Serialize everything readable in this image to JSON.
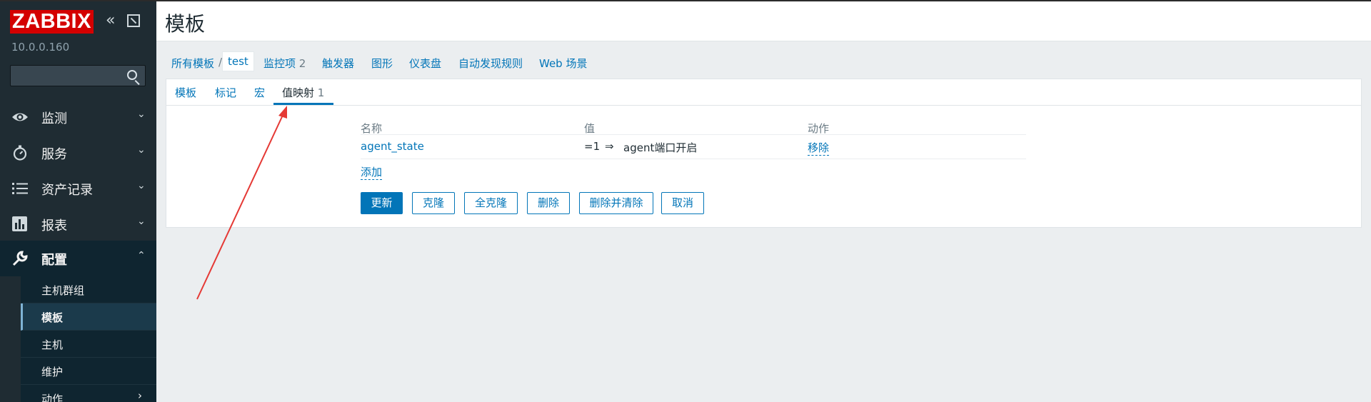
{
  "sidebar": {
    "logo": "ZABBIX",
    "version": "10.0.0.160",
    "search": {
      "value": "",
      "placeholder": ""
    },
    "icons": {
      "collapse": "double-chevron-left-icon",
      "kiosk": "kiosk-mode-icon",
      "search": "search-icon"
    },
    "menu": [
      {
        "label": "监测",
        "icon": "eye-icon",
        "chevron": "⌄"
      },
      {
        "label": "服务",
        "icon": "stopwatch-icon",
        "chevron": "⌄"
      },
      {
        "label": "资产记录",
        "icon": "list-icon",
        "chevron": "⌄"
      },
      {
        "label": "报表",
        "icon": "bar-chart-icon",
        "chevron": "⌄"
      },
      {
        "label": "配置",
        "icon": "wrench-icon",
        "chevron": "⌃"
      }
    ],
    "submenu": [
      {
        "label": "主机群组"
      },
      {
        "label": "模板"
      },
      {
        "label": "主机"
      },
      {
        "label": "维护"
      },
      {
        "label": "动作",
        "chevron": "›"
      }
    ]
  },
  "header": {
    "title": "模板"
  },
  "breadcrumb": {
    "all_templates": "所有模板",
    "separator": "/",
    "current": "test",
    "items_label": "监控项",
    "items_count": "2",
    "triggers": "触发器",
    "graphs": "图形",
    "dashboards": "仪表盘",
    "discovery": "自动发现规则",
    "web": "Web 场景"
  },
  "tabs": {
    "template": "模板",
    "tags": "标记",
    "macros": "宏",
    "valuemap_label": "值映射",
    "valuemap_count": "1"
  },
  "valuemaps": {
    "columns": {
      "name": "名称",
      "value": "值",
      "action": "动作"
    },
    "rows": [
      {
        "name": "agent_state",
        "value": "=1",
        "arrow": "⇒",
        "mapped": "agent端口开启",
        "action": "移除"
      }
    ],
    "add_label": "添加"
  },
  "buttons": {
    "update": "更新",
    "clone": "克隆",
    "full_clone": "全克隆",
    "delete": "删除",
    "delete_clear": "删除并清除",
    "cancel": "取消"
  },
  "colors": {
    "brand_red": "#d40000",
    "sidebar_bg": "#1f2c33",
    "link_blue": "#0275b8",
    "annotation_arrow": "#e53935"
  }
}
